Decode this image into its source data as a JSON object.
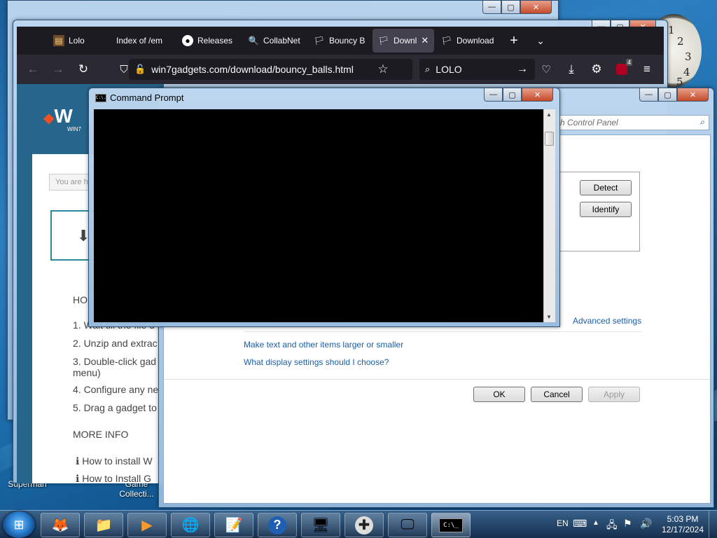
{
  "desktop": {
    "label_left": "Superman",
    "label_mid_1": "Game",
    "label_mid_2": "Collecti..."
  },
  "clock": {
    "numerals": [
      "2",
      "3",
      "4",
      "5",
      "1"
    ]
  },
  "browser": {
    "tabs": [
      {
        "label": "Lolo",
        "icon": "lolo-icon",
        "active": false
      },
      {
        "label": "Index of /em",
        "icon": "",
        "active": false
      },
      {
        "label": "Releases",
        "icon": "github-icon",
        "active": false
      },
      {
        "label": "CollabNet",
        "icon": "search-icon",
        "active": false
      },
      {
        "label": "Bouncy B",
        "icon": "windows-flag-icon",
        "active": false
      },
      {
        "label": "Downl",
        "icon": "windows-flag-icon",
        "active": true
      },
      {
        "label": "Download",
        "icon": "windows-flag-icon",
        "active": false
      }
    ],
    "url": "win7gadgets.com/download/bouncy_balls.html",
    "search_value": "LOLO",
    "extension_badge": "4",
    "page": {
      "logo_letter": "W",
      "logo_sub": "WIN7",
      "breadcrumb_placeholder": "You are h",
      "heading": "HO",
      "steps": [
        "1. Wait till the file d",
        "2. Unzip and extrac",
        "3. Double-click gad",
        "menu)",
        "4. Configure any ne",
        "5. Drag a gadget to"
      ],
      "more_info": "MORE INFO",
      "info_links": [
        "How to install W",
        "How to Install G"
      ]
    }
  },
  "control_panel": {
    "search_placeholder": "ch Control Panel",
    "detect_label": "Detect",
    "identify_label": "Identify",
    "advanced_settings": "Advanced settings",
    "link_text_size": "Make text and other items larger or smaller",
    "link_display_help": "What display settings should I choose?",
    "ok_label": "OK",
    "cancel_label": "Cancel",
    "apply_label": "Apply"
  },
  "cmd": {
    "title": "Command Prompt",
    "icon_text": "C:\\."
  },
  "back_window": {
    "min": "—",
    "max": "▢",
    "close": "✕"
  },
  "taskbar": {
    "apps": [
      {
        "name": "firefox",
        "glyph": "🦊"
      },
      {
        "name": "explorer",
        "glyph": "📁"
      },
      {
        "name": "media-player",
        "glyph": "▶"
      },
      {
        "name": "edge",
        "glyph": "🌐"
      },
      {
        "name": "notepad",
        "glyph": "📝"
      },
      {
        "name": "help",
        "glyph": "?"
      },
      {
        "name": "control-panel",
        "glyph": "🖥"
      },
      {
        "name": "gamepad",
        "glyph": "✚"
      },
      {
        "name": "display",
        "glyph": "🖵"
      },
      {
        "name": "cmd",
        "glyph": "C:\\_"
      }
    ],
    "language": "EN",
    "time": "5:03 PM",
    "date": "12/17/2024"
  }
}
